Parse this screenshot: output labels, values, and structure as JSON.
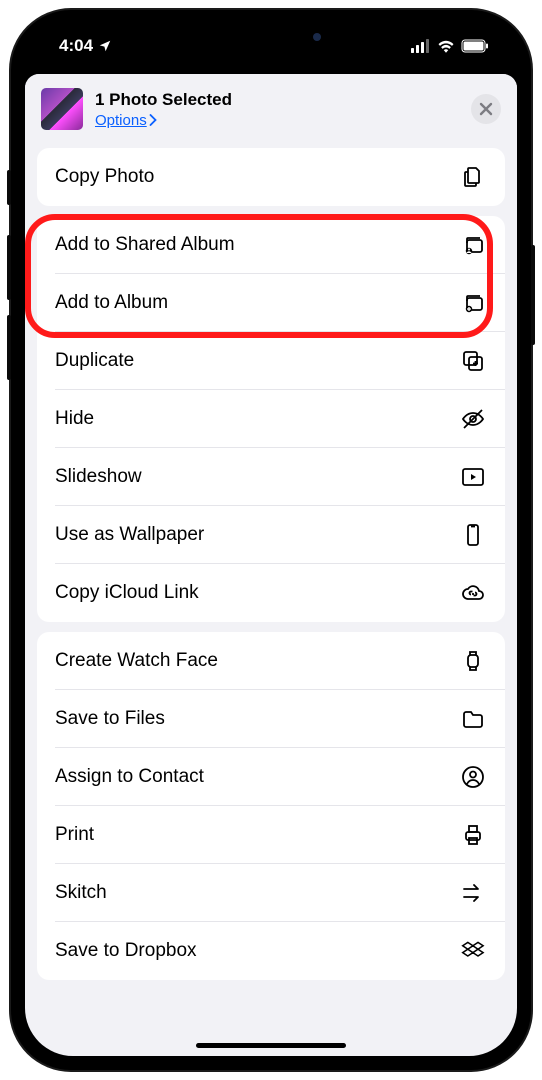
{
  "status": {
    "time": "4:04"
  },
  "header": {
    "title": "1 Photo Selected",
    "options": "Options"
  },
  "groups": [
    {
      "rows": [
        {
          "label": "Copy Photo",
          "icon": "copy-doc"
        }
      ]
    },
    {
      "rows": [
        {
          "label": "Add to Shared Album",
          "icon": "shared-album"
        },
        {
          "label": "Add to Album",
          "icon": "add-album"
        },
        {
          "label": "Duplicate",
          "icon": "duplicate"
        },
        {
          "label": "Hide",
          "icon": "hide"
        },
        {
          "label": "Slideshow",
          "icon": "slideshow"
        },
        {
          "label": "Use as Wallpaper",
          "icon": "wallpaper"
        },
        {
          "label": "Copy iCloud Link",
          "icon": "cloud-link"
        }
      ]
    },
    {
      "rows": [
        {
          "label": "Create Watch Face",
          "icon": "watch"
        },
        {
          "label": "Save to Files",
          "icon": "folder"
        },
        {
          "label": "Assign to Contact",
          "icon": "contact"
        },
        {
          "label": "Print",
          "icon": "print"
        },
        {
          "label": "Skitch",
          "icon": "skitch"
        },
        {
          "label": "Save to Dropbox",
          "icon": "dropbox"
        }
      ]
    }
  ]
}
